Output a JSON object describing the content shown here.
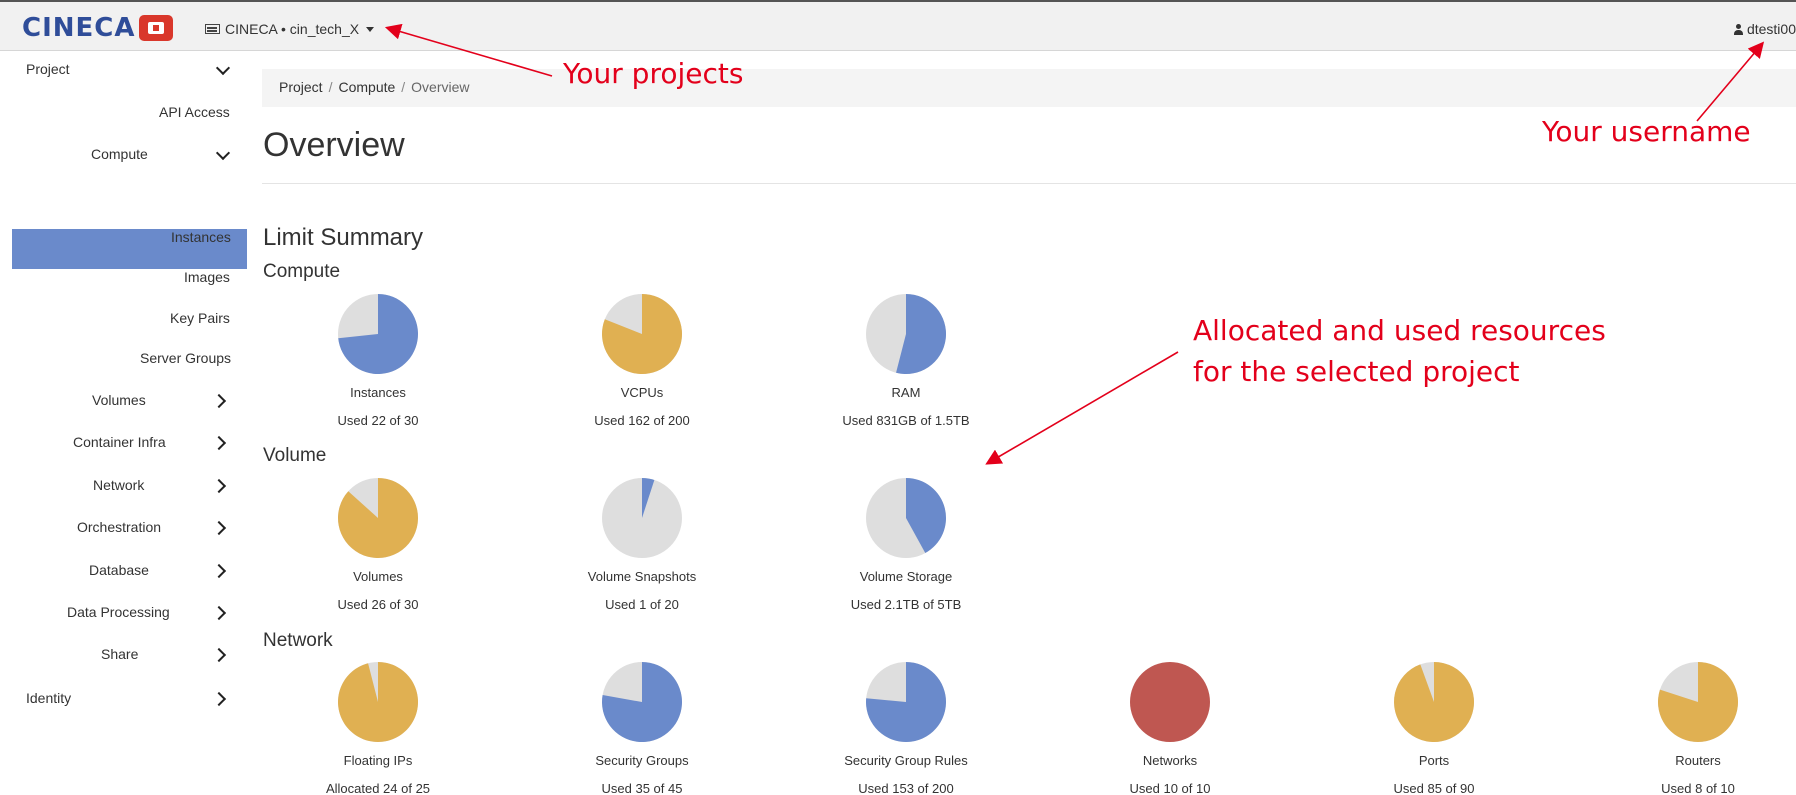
{
  "topbar": {
    "logo_text": "CINECA",
    "project_switcher": "CINECA • cin_tech_X",
    "username": "dtesti00"
  },
  "sidebar": {
    "project": "Project",
    "api_access": "API Access",
    "compute": "Compute",
    "overview": "Overview",
    "instances": "Instances",
    "images": "Images",
    "key_pairs": "Key Pairs",
    "server_groups": "Server Groups",
    "volumes": "Volumes",
    "container_infra": "Container Infra",
    "network": "Network",
    "orchestration": "Orchestration",
    "database": "Database",
    "data_processing": "Data Processing",
    "share": "Share",
    "identity": "Identity"
  },
  "breadcrumb": {
    "project": "Project",
    "sep1": "/",
    "compute": "Compute",
    "sep2": "/",
    "current": "Overview"
  },
  "page": {
    "title": "Overview",
    "limit_summary": "Limit Summary",
    "sections": {
      "compute": "Compute",
      "volume": "Volume",
      "network": "Network"
    }
  },
  "colors": {
    "blue": "#6a8acb",
    "yellow": "#e0b052",
    "red": "#bf5751",
    "grey": "#dedede",
    "accent": "#e3001b"
  },
  "charts": [
    {
      "name": "Instances",
      "usage": "Used 22 of 30",
      "fraction": 0.7333,
      "color": "blue"
    },
    {
      "name": "VCPUs",
      "usage": "Used 162 of 200",
      "fraction": 0.81,
      "color": "yellow"
    },
    {
      "name": "RAM",
      "usage": "Used 831GB of 1.5TB",
      "fraction": 0.54,
      "color": "blue"
    },
    {
      "name": "Volumes",
      "usage": "Used 26 of 30",
      "fraction": 0.8667,
      "color": "yellow"
    },
    {
      "name": "Volume Snapshots",
      "usage": "Used 1 of 20",
      "fraction": 0.05,
      "color": "blue"
    },
    {
      "name": "Volume Storage",
      "usage": "Used 2.1TB of 5TB",
      "fraction": 0.42,
      "color": "blue"
    },
    {
      "name": "Floating IPs",
      "usage": "Allocated 24 of 25",
      "fraction": 0.96,
      "color": "yellow"
    },
    {
      "name": "Security Groups",
      "usage": "Used 35 of 45",
      "fraction": 0.7778,
      "color": "blue"
    },
    {
      "name": "Security Group Rules",
      "usage": "Used 153 of 200",
      "fraction": 0.765,
      "color": "blue"
    },
    {
      "name": "Networks",
      "usage": "Used 10 of 10",
      "fraction": 1.0,
      "color": "red"
    },
    {
      "name": "Ports",
      "usage": "Used 85 of 90",
      "fraction": 0.9444,
      "color": "yellow"
    },
    {
      "name": "Routers",
      "usage": "Used 8 of 10",
      "fraction": 0.8,
      "color": "yellow"
    }
  ],
  "annotations": {
    "projects": "Your projects",
    "username": "Your username",
    "resources_line1": "Allocated and used resources",
    "resources_line2": "for the selected project"
  }
}
